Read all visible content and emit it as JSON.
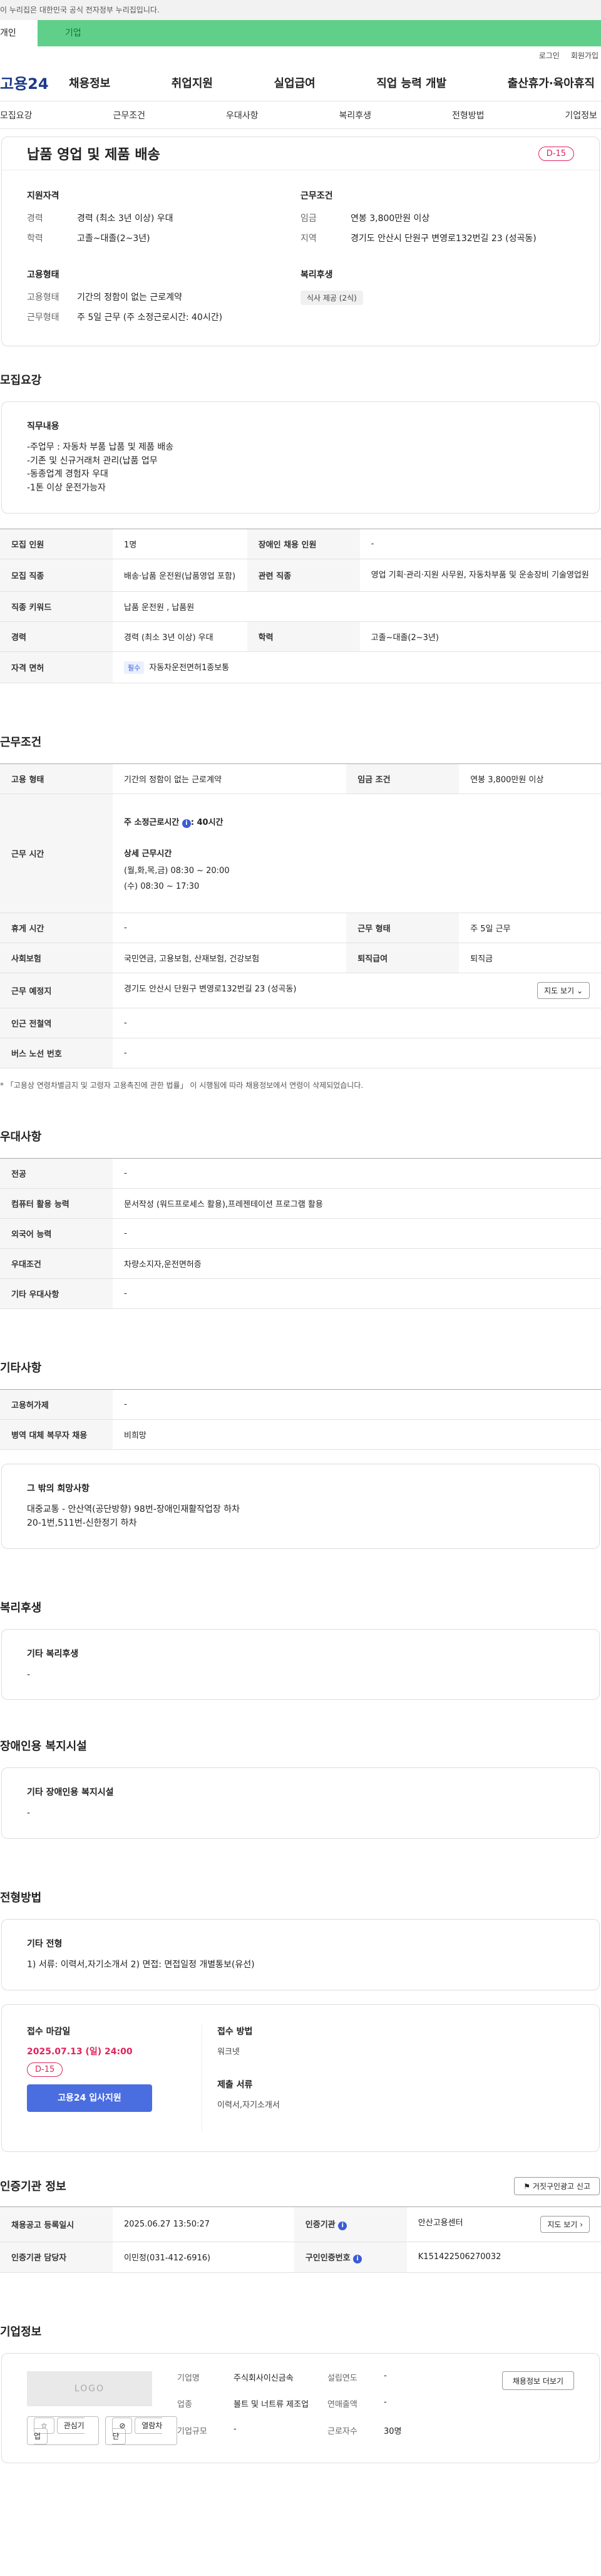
{
  "gov_bar": "이 누리집은 대한민국 공식 전자정부 누리집입니다.",
  "user_tabs": {
    "person": "개인",
    "company": "기업"
  },
  "util": {
    "login": "로그인",
    "join": "회원가입"
  },
  "logo": "고용24",
  "gnb": [
    "채용정보",
    "취업지원",
    "실업급여",
    "직업 능력 개발",
    "출산휴가·육아휴직"
  ],
  "subnav": [
    "모집요강",
    "근무조건",
    "우대사항",
    "복리후생",
    "전형방법",
    "기업정보"
  ],
  "job": {
    "title": "납품 영업 및 제품 배송",
    "dday": "D-15",
    "qual_title": "지원자격",
    "career_k": "경력",
    "career_v": "경력 (최소 3년 이상) 우대",
    "edu_k": "학력",
    "edu_v": "고졸~대졸(2~3년)",
    "cond_title": "근무조건",
    "wage_k": "임금",
    "wage_v": "연봉 3,800만원 이상",
    "area_k": "지역",
    "area_v": "경기도 안산시 단원구 변영로132번길 23 (성곡동)",
    "emp_title": "고용형태",
    "emp_k": "고용형태",
    "emp_v": "기간의 정함이 없는 근로계약",
    "work_k": "근무형태",
    "work_v": "주 5일 근무 (주 소정근로시간: 40시간)",
    "welfare_title": "복리후생",
    "welfare_badge": "식사 제공 (2식)"
  },
  "recruit": {
    "title": "모집요강",
    "duty_title": "직무내용",
    "duty_text": "-주업무 : 자동차 부품 납품 및 제품 배송\n-기존 및 신규거래처 관리(납품 업무\n-동종업계 경험자 우대\n-1톤 이상 운전가능자",
    "rows": {
      "count_k": "모집 인원",
      "count_v": "1명",
      "disabled_k": "장애인 채용 인원",
      "disabled_v": "-",
      "job_k": "모집 직종",
      "job_v": "배송·납품 운전원(납품영업 포함)",
      "rel_k": "관련 직종",
      "rel_v": "영업 기획·관리·지원 사무원, 자동차부품 및 운송장비 기술영업원",
      "kw_k": "직종 키워드",
      "kw_v": "납품 운전원 , 납품원",
      "career_k": "경력",
      "career_v": "경력 (최소 3년 이상) 우대",
      "edu_k": "학력",
      "edu_v": "고졸~대졸(2~3년)",
      "license_k": "자격 면허",
      "license_tag": "필수",
      "license_v": "자동차운전면허1종보통"
    }
  },
  "work": {
    "title": "근무조건",
    "emp_k": "고용 형태",
    "emp_v": "기간의 정함이 없는 근로계약",
    "wage_k": "임금 조건",
    "wage_v": "연봉 3,800만원 이상",
    "hours_k": "근무 시간",
    "hours_weekly": "주 소정근로시간",
    "hours_weekly_v": ": 40시간",
    "hours_detail_title": "상세 근무시간",
    "hours_detail_1": "(월,화,목,금) 08:30 ~ 20:00",
    "hours_detail_2": "(수) 08:30 ~ 17:30",
    "rest_k": "휴게 시간",
    "rest_v": "-",
    "type_k": "근무 형태",
    "type_v": "주 5일 근무",
    "ins_k": "사회보험",
    "ins_v": "국민연금, 고용보험, 산재보험, 건강보험",
    "sev_k": "퇴직급여",
    "sev_v": "퇴직금",
    "place_k": "근무 예정지",
    "place_v": "경기도 안산시 단원구 변영로132번길 23 (성곡동)",
    "map_btn": "지도 보기",
    "subway_k": "인근 전철역",
    "subway_v": "-",
    "bus_k": "버스 노선 번호",
    "bus_v": "-",
    "note": "* 「고용상 연령차별금지 및 고령자 고용촉진에 관한 법률」 이 시행됨에 따라 채용정보에서 연령이 삭제되었습니다."
  },
  "prefer": {
    "title": "우대사항",
    "major_k": "전공",
    "major_v": "-",
    "pc_k": "컴퓨터 활용 능력",
    "pc_v": "문서작성 (워드프로세스 활용),프레젠테이션 프로그램 활용",
    "lang_k": "외국어 능력",
    "lang_v": "-",
    "cond_k": "우대조건",
    "cond_v": "차량소지자,운전면허증",
    "etc_k": "기타 우대사항",
    "etc_v": "-"
  },
  "others": {
    "title": "기타사항",
    "emp_k": "고용허가제",
    "emp_v": "-",
    "mil_k": "병역 대체 복무자 채용",
    "mil_v": "비희망",
    "extra_title": "그 밖의 희망사항",
    "extra_text": "대중교통 - 안산역(공단방향) 98번-장애인재활작업장 하차\n                              20-1번,511번-신한정기 하차"
  },
  "welfare": {
    "title": "복리후생",
    "sub": "기타 복리후생",
    "text": "-"
  },
  "facility": {
    "title": "장애인용 복지시설",
    "sub": "기타 장애인용 복지시설",
    "text": "-"
  },
  "process": {
    "title": "전형방법",
    "sub": "기타 전형",
    "text": "1) 서류: 이력서,자기소개서 2) 면접: 면접일정 개별통보(유선)",
    "deadline_lbl": "접수 마감일",
    "deadline": "2025.07.13 (일) 24:00",
    "dday": "D-15",
    "apply_btn": "고용24 입사지원",
    "method_lbl": "접수 방법",
    "method_v": "워크넷",
    "docs_lbl": "제출 서류",
    "docs_v": "이력서,자기소개서"
  },
  "cert": {
    "title": "인증기관 정보",
    "report_btn": "거짓구인광고 신고",
    "reg_k": "채용공고 등록일시",
    "reg_v": "2025.06.27 13:50:27",
    "org_k": "인증기관",
    "org_v": "안산고용센터",
    "map_btn": "지도 보기",
    "staff_k": "인증기관 담당자",
    "staff_v": "이민정(031-412-6916)",
    "no_k": "구인인증번호",
    "no_v": "K151422506270032"
  },
  "company": {
    "title": "기업정보",
    "logo": "LOGO",
    "fav_btn": "관심기업",
    "block_btn": "열람차단",
    "name_k": "기업명",
    "name_v": "주식회사이신금속",
    "found_k": "설립연도",
    "found_v": "-",
    "ind_k": "업종",
    "ind_v": "볼트 및 너트류 제조업",
    "sales_k": "연매출액",
    "sales_v": "-",
    "staff_k": "근로자수",
    "staff_v": "30명",
    "size_k": "기업규모",
    "size_v": "-",
    "info_btn": "채용정보 더보기"
  }
}
